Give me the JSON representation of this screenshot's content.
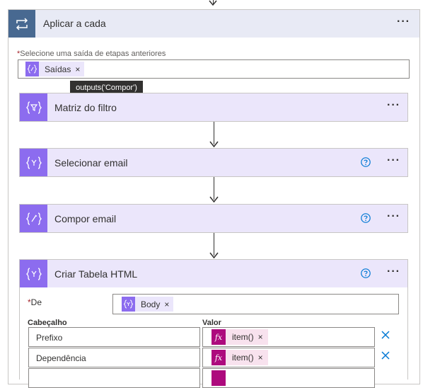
{
  "apply_each": {
    "title": "Aplicar a cada",
    "more": "···",
    "select_label": "Selecione uma saída de etapas anteriores",
    "required_mark": "*",
    "token": {
      "label": "Saídas",
      "remove": "×"
    },
    "tooltip": "outputs('Compor')"
  },
  "actions": [
    {
      "title": "Matriz do filtro",
      "icon": "filter-array-icon",
      "more": "···",
      "help": false
    },
    {
      "title": "Selecionar email",
      "icon": "select-icon",
      "more": "···",
      "help": true
    },
    {
      "title": "Compor email",
      "icon": "compose-icon",
      "more": "···",
      "help": true
    },
    {
      "title": "Criar Tabela HTML",
      "icon": "html-table-icon",
      "more": "···",
      "help": true
    }
  ],
  "html_table": {
    "from_label": "De",
    "required_mark": "*",
    "from_token": {
      "label": "Body",
      "remove": "×"
    },
    "header_col": "Cabeçalho",
    "value_col": "Valor",
    "rows": [
      {
        "header": "Prefixo",
        "value": "item()",
        "remove": "×"
      },
      {
        "header": "Dependência",
        "value": "item()",
        "remove": "×"
      }
    ],
    "fx": "fx"
  },
  "colors": {
    "loop_accent": "#486991",
    "data_ops_accent": "#8c6cef",
    "expression_accent": "#ad0a7d",
    "help_accent": "#0078d4"
  }
}
